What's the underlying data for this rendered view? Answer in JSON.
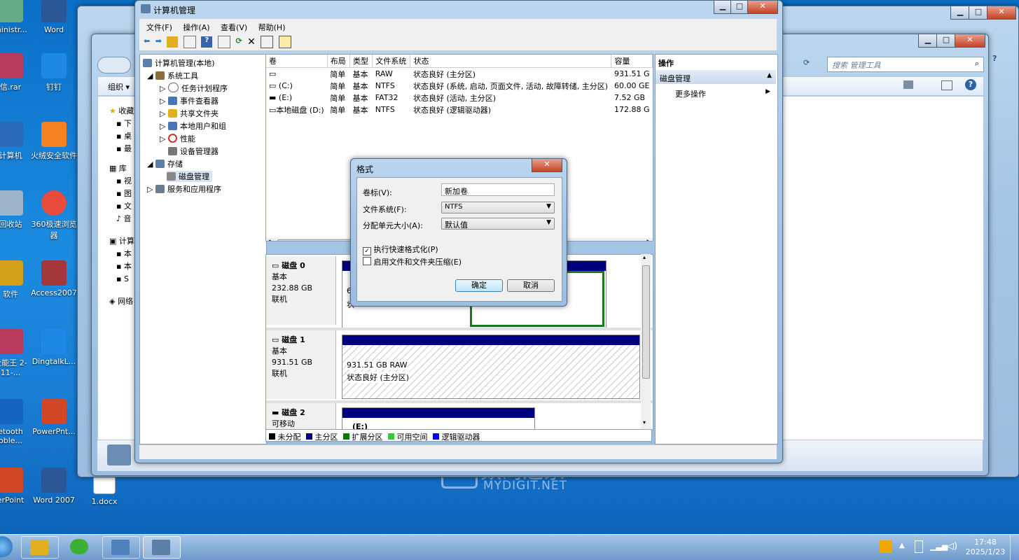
{
  "desktop": {
    "icons": [
      {
        "label": "ministr...",
        "color": "#6a8"
      },
      {
        "label": "Word",
        "color": "#2b5797"
      },
      {
        "label": "信.rar",
        "color": "#b83b5e"
      },
      {
        "label": "钉钉",
        "color": "#1e88e5"
      },
      {
        "label": "计算机",
        "color": "#2a6ab8"
      },
      {
        "label": "火绒安全软件",
        "color": "#f58220"
      },
      {
        "label": "回收站",
        "color": "#9cb3c9"
      },
      {
        "label": "360极速浏览器",
        "color": "#e94b3c"
      },
      {
        "label": "软件",
        "color": "#d4a017"
      },
      {
        "label": "Access2007",
        "color": "#a4373a"
      },
      {
        "label": "全能王 2-11-...",
        "color": "#b83b5e"
      },
      {
        "label": "DingtalkL...",
        "color": "#1e88e5"
      },
      {
        "label": "etooth oble...",
        "color": "#1565c0"
      },
      {
        "label": "PowerPnt...",
        "color": "#d24726"
      },
      {
        "label": "erPoint",
        "color": "#d24726"
      },
      {
        "label": "Word 2007",
        "color": "#2b5797"
      },
      {
        "label": "1.docx",
        "color": "#ffffff"
      }
    ],
    "watermark": {
      "cn": "数码之家",
      "en": "MYDIGIT.NET"
    }
  },
  "taskbar": {
    "time": "17:48",
    "date": "2025/1/23"
  },
  "explorer": {
    "search_placeholder": "搜索 管理工具"
  },
  "main_window": {
    "title": "计算机管理",
    "menu": [
      "文件(F)",
      "操作(A)",
      "查看(V)",
      "帮助(H)"
    ],
    "tree": [
      {
        "label": "计算机管理(本地)",
        "level": 0,
        "color": "#5b7fa6"
      },
      {
        "label": "系统工具",
        "level": 1,
        "color": "#8a6d3b"
      },
      {
        "label": "任务计划程序",
        "level": 2,
        "color": "#666"
      },
      {
        "label": "事件查看器",
        "level": 2,
        "color": "#4a77b4"
      },
      {
        "label": "共享文件夹",
        "level": 2,
        "color": "#e0b020"
      },
      {
        "label": "本地用户和组",
        "level": 2,
        "color": "#4a77b4"
      },
      {
        "label": "性能",
        "level": 2,
        "color": "#c33"
      },
      {
        "label": "设备管理器",
        "level": 2,
        "color": "#777"
      },
      {
        "label": "存储",
        "level": 1,
        "color": "#5b7fa6"
      },
      {
        "label": "磁盘管理",
        "level": 2,
        "color": "#888"
      },
      {
        "label": "服务和应用程序",
        "level": 1,
        "color": "#6a7d90"
      }
    ],
    "columns": [
      "卷",
      "布局",
      "类型",
      "文件系统",
      "状态",
      "容量"
    ],
    "volumes": [
      {
        "vol": "",
        "layout": "简单",
        "type": "基本",
        "fs": "RAW",
        "status": "状态良好 (主分区)",
        "size": "931.51 G"
      },
      {
        "vol": "(C:)",
        "layout": "简单",
        "type": "基本",
        "fs": "NTFS",
        "status": "状态良好 (系统, 启动, 页面文件, 活动, 故障转储, 主分区)",
        "size": "60.00 GE"
      },
      {
        "vol": "(E:)",
        "layout": "简单",
        "type": "基本",
        "fs": "FAT32",
        "status": "状态良好 (活动, 主分区)",
        "size": "7.52 GB"
      },
      {
        "vol": "本地磁盘 (D:)",
        "layout": "简单",
        "type": "基本",
        "fs": "NTFS",
        "status": "状态良好 (逻辑驱动器)",
        "size": "172.88 G"
      }
    ],
    "disks": [
      {
        "name": "磁盘 0",
        "kind": "基本",
        "size": "232.88 GB",
        "state": "联机"
      },
      {
        "name": "磁盘 1",
        "kind": "基本",
        "size": "931.51 GB",
        "state": "联机",
        "part_size": "931.51 GB RAW",
        "part_status": "状态良好 (主分区)"
      },
      {
        "name": "磁盘 2",
        "kind": "可移动",
        "part_label": "(E:)"
      }
    ],
    "disk0_partial_text": [
      "6",
      "状"
    ],
    "legend": [
      {
        "label": "未分配",
        "color": "#000000"
      },
      {
        "label": "主分区",
        "color": "#00007f"
      },
      {
        "label": "扩展分区",
        "color": "#008000"
      },
      {
        "label": "可用空间",
        "color": "#33cc33"
      },
      {
        "label": "逻辑驱动器",
        "color": "#0000ff"
      }
    ],
    "actions": {
      "header": "操作",
      "section": "磁盘管理",
      "more": "更多操作"
    }
  },
  "explorer_sidebar": {
    "org": "组织 ▾",
    "items": [
      "收藏",
      "下",
      "桌",
      "最",
      "库",
      "视",
      "图",
      "文",
      "音",
      "计算",
      "本",
      "本",
      "S",
      "网络"
    ]
  },
  "dialog": {
    "title": "格式",
    "label_volume": "卷标(V):",
    "value_volume": "新加卷",
    "label_fs": "文件系统(F):",
    "value_fs": "NTFS",
    "label_alloc": "分配单元大小(A):",
    "value_alloc": "默认值",
    "quick_format": "执行快速格式化(P)",
    "quick_checked": true,
    "compress": "启用文件和文件夹压缩(E)",
    "compress_checked": false,
    "ok": "确定",
    "cancel": "取消"
  }
}
